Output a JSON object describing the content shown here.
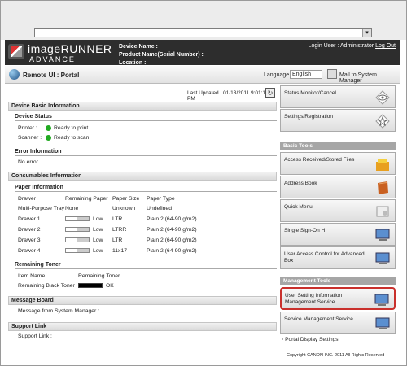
{
  "address_bar": {
    "value": "",
    "dropdown": "▾"
  },
  "header": {
    "brand_line1": "imageRUNNER",
    "brand_line2": "ADVANCE",
    "device_name_label": "Device Name :",
    "product_name_label": "Product Name(Serial Number) :",
    "location_label": "Location :",
    "login_text": "Login User : Administrator",
    "logout": "Log Out"
  },
  "portal": {
    "title": "Remote UI : Portal",
    "language_label": "Language",
    "language_value": "English",
    "mail_link": "Mail to System Manager"
  },
  "main": {
    "last_updated": "Last Updated : 01/13/2011 9:01:18 PM",
    "device_basic_info": "Device Basic Information",
    "device_status": "Device Status",
    "printer_label": "Printer :",
    "printer_status": "Ready to print.",
    "scanner_label": "Scanner :",
    "scanner_status": "Ready to scan.",
    "error_info": "Error Information",
    "no_error": "No error",
    "consumables": "Consumables Information",
    "paper_info": "Paper Information",
    "paper_headers": [
      "Drawer",
      "Remaining Paper",
      "Paper Size",
      "Paper Type"
    ],
    "paper_rows": [
      {
        "drawer": "Multi-Purpose Tray",
        "remaining": "None",
        "size": "Unknown",
        "type": "Undefined"
      },
      {
        "drawer": "Drawer 1",
        "remaining": "Low",
        "size": "LTR",
        "type": "Plain 2 (64-90 g/m2)"
      },
      {
        "drawer": "Drawer 2",
        "remaining": "Low",
        "size": "LTRR",
        "type": "Plain 2 (64-90 g/m2)"
      },
      {
        "drawer": "Drawer 3",
        "remaining": "Low",
        "size": "LTR",
        "type": "Plain 2 (64-90 g/m2)"
      },
      {
        "drawer": "Drawer 4",
        "remaining": "Low",
        "size": "11x17",
        "type": "Plain 2 (64-90 g/m2)"
      }
    ],
    "remaining_toner": "Remaining Toner",
    "toner_headers": [
      "Item Name",
      "Remaining Toner"
    ],
    "toner_row": {
      "name": "Remaining Black Toner",
      "status": "OK"
    },
    "message_board": "Message Board",
    "message_text": "Message from System Manager :",
    "support_link": "Support Link",
    "support_text": "Support Link :"
  },
  "right": {
    "status_monitor": "Status Monitor/Cancel",
    "settings": "Settings/Registration",
    "basic_tools": "Basic Tools",
    "access_files": "Access Received/Stored Files",
    "address_book": "Address Book",
    "quick_menu": "Quick Menu",
    "single_sign_on": "Single Sign-On H",
    "user_access": "User Access Control for Advanced Box",
    "management_tools": "Management Tools",
    "user_setting_mgmt": "User Setting Information Management Service",
    "service_mgmt": "Service Management Service",
    "portal_display": "Portal Display Settings",
    "copyright": "Copyright CANON INC. 2011 All Rights Reserved"
  }
}
